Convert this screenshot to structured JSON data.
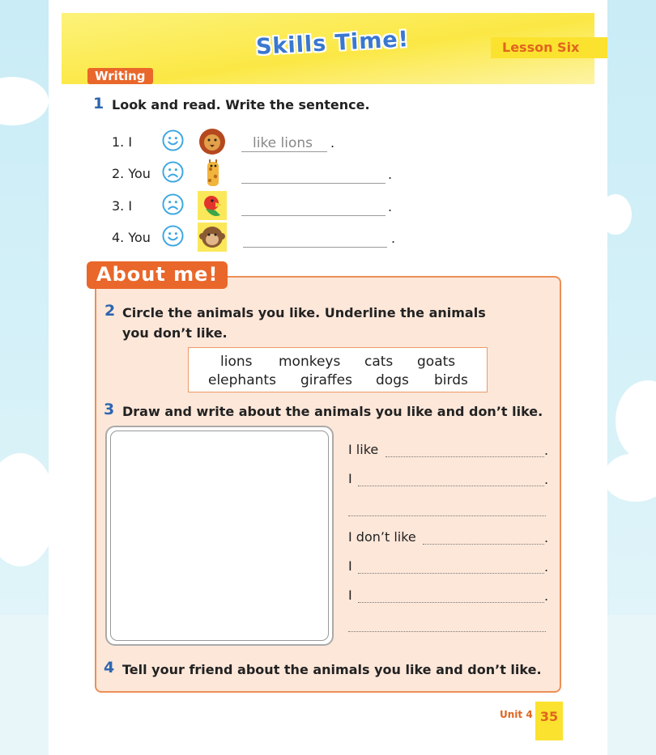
{
  "header": {
    "title": "Skills Time!",
    "lesson": "Lesson Six",
    "section_tag": "Writing"
  },
  "q1": {
    "number": "1",
    "instruction": "Look and read. Write the sentence.",
    "rows": [
      {
        "num": "1. I",
        "face": "smiley-face-icon",
        "animal": "lion-icon",
        "answer": "like lions"
      },
      {
        "num": "2. You",
        "face": "sad-face-icon",
        "animal": "giraffe-icon",
        "answer": ""
      },
      {
        "num": "3. I",
        "face": "sad-face-icon",
        "animal": "parrot-icon",
        "answer": ""
      },
      {
        "num": "4. You",
        "face": "smiley-face-icon",
        "animal": "monkey-icon",
        "answer": ""
      }
    ],
    "end_mark": "."
  },
  "about": {
    "tag": "About me!",
    "q2": {
      "number": "2",
      "instruction_line1": "Circle the animals you like. Underline the animals",
      "instruction_line2": "you don’t like."
    },
    "words_row1": [
      "lions",
      "monkeys",
      "cats",
      "goats"
    ],
    "words_row2": [
      "elephants",
      "giraffes",
      "dogs",
      "birds"
    ],
    "q3": {
      "number": "3",
      "instruction": "Draw and write about the animals you like and don’t like."
    },
    "prompts": {
      "like": "I like",
      "i": "I",
      "dont_like": "I don’t like",
      "period": "."
    },
    "q4": {
      "number": "4",
      "instruction": "Tell your friend about the animals you like and don’t like."
    }
  },
  "footer": {
    "unit": "Unit 4",
    "page": "35"
  },
  "colors": {
    "accent_orange": "#e9672a",
    "number_blue": "#2d66b0",
    "banner_yellow": "#fbe845"
  }
}
